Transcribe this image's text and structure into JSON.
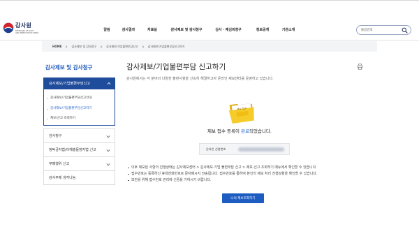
{
  "header": {
    "logo": {
      "name_ko": "감사원",
      "name_en_line1": "THE BOARD OF AUDIT",
      "name_en_line2": "AND INSPECTION OF KOREA",
      "icon": "bai-emblem-icon"
    },
    "nav": [
      {
        "label": "알림"
      },
      {
        "label": "감사결과"
      },
      {
        "label": "자료실"
      },
      {
        "label": "감사제보 및 감사청구",
        "active": true
      },
      {
        "label": "심사 · 재심의청구"
      },
      {
        "label": "정보공개"
      },
      {
        "label": "기관소개"
      }
    ],
    "search": {
      "placeholder": "통합검색",
      "value": "",
      "icon": "search-icon"
    }
  },
  "breadcrumb": {
    "home": "HOME",
    "items": [
      "감사제보 및 감사청구",
      "감사제보/기업불편부담신고",
      "감사제보/기업불편부담신고하기"
    ],
    "separator_icon": "chevron-right-icon"
  },
  "sidebar": {
    "title": "감사제보 및 감사청구",
    "active_group": {
      "label": "감사제보/기업불편부담신고",
      "icon": "chevron-up-icon",
      "items": [
        {
          "label": "감사제보/기업불편부담신고안내"
        },
        {
          "label": "감사제보/기업불편부담신고하기",
          "active": true
        },
        {
          "label": "제보/신고 조회하기"
        }
      ]
    },
    "groups": [
      {
        "label": "감사청구",
        "icon": "chevron-down-icon"
      },
      {
        "label": "청탁금지법/이해충돌방지법 신고",
        "icon": "chevron-down-icon"
      },
      {
        "label": "부패행위 신고",
        "icon": "chevron-down-icon"
      },
      {
        "label": "감사주제 생각나눔"
      }
    ]
  },
  "main": {
    "title": "감사제보/기업불편부담 신고하기",
    "description": "감사원에서는 각 분야의 다양한 불편사항을 신속히 해결하고자 온라인 제보센터를 운영하고 있습니다.",
    "print_icon": "printer-icon",
    "folder": {
      "label": "제보 접수",
      "icon": "folder-icon"
    },
    "message": {
      "before": "제보 접수 등록이 ",
      "highlight": "완료",
      "after": "되었습니다."
    },
    "application_number": {
      "label": "온라인 신청번호"
    },
    "notes": [
      "이후 제보된 사항의 진행상태는 감사제보센터 > 감사제보·기업 불편부담 신고 > 제보·신고 조회하기 메뉴에서 확인할 수 있습니다.",
      "접수번호는 등록하신 휴대전화번호로 문자메시지 전송됩니다. 접수번호를 통하여 본인의 제보 처리 진행상황을 확인할 수 있습니다.",
      "보안을 위해 접수번호 관리에 신중을 기하시기 바랍니다."
    ],
    "button_label": "나의 제보조회하기"
  },
  "colors": {
    "primary_navy": "#1f4c9b",
    "accent_blue": "#1f5fc8",
    "button_blue": "#1d5cc0",
    "folder_yellow": "#f6cc2b"
  }
}
